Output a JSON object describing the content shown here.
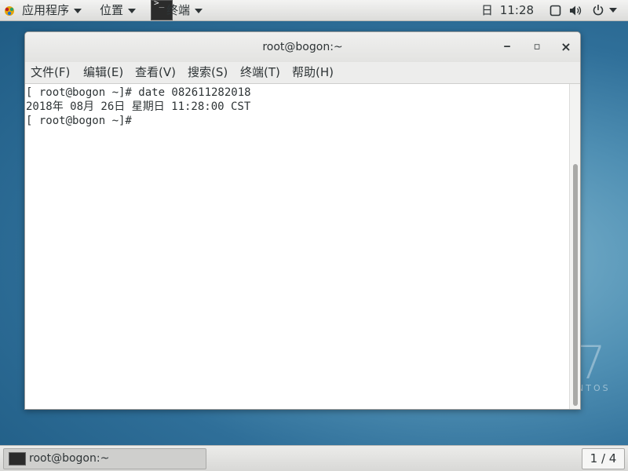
{
  "topbar": {
    "apps_label": "应用程序",
    "places_label": "位置",
    "terminal_label": "终端",
    "day": "日",
    "time": "11:28"
  },
  "window": {
    "title": "root@bogon:~",
    "minimize": "‒",
    "maximize": "▫",
    "close": "×"
  },
  "menu": {
    "items": [
      {
        "label": "文件(F)"
      },
      {
        "label": "编辑(E)"
      },
      {
        "label": "查看(V)"
      },
      {
        "label": "搜索(S)"
      },
      {
        "label": "终端(T)"
      },
      {
        "label": "帮助(H)"
      }
    ]
  },
  "terminal": {
    "lines": [
      "[ root@bogon ~]# date 082611282018",
      "2018年 08月 26日 星期日 11:28:00 CST",
      "[ root@bogon ~]# "
    ]
  },
  "desktop": {
    "watermark_number": "7",
    "watermark_text": "NTOS"
  },
  "bottombar": {
    "task_label": "root@bogon:~",
    "workspace": "1 / 4"
  },
  "colors": {
    "accent": "#2e3436",
    "desktop": "#2f6f99"
  }
}
